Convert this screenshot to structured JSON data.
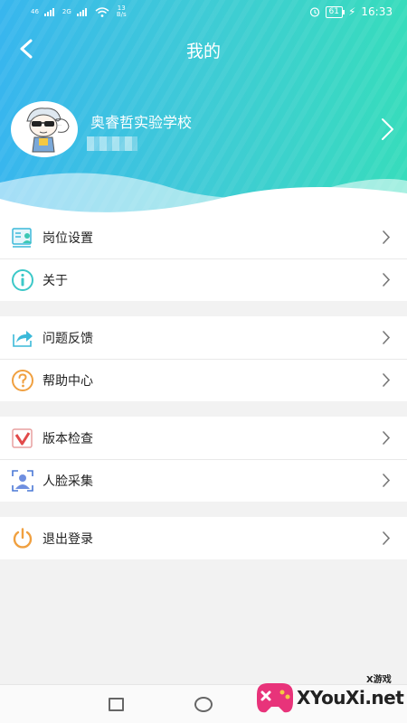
{
  "status_bar": {
    "left_labels": [
      "46",
      "2G"
    ],
    "speed_value": "13",
    "speed_unit": "B/s",
    "battery": "61",
    "time": "16:33"
  },
  "header": {
    "title": "我的",
    "back_icon": "back-arrow-icon"
  },
  "profile": {
    "school_name": "奥睿哲实验学校"
  },
  "menu": {
    "groups": [
      {
        "items": [
          {
            "label": "岗位设置",
            "icon": "position-settings-icon"
          },
          {
            "label": "关于",
            "icon": "info-icon"
          }
        ]
      },
      {
        "items": [
          {
            "label": "问题反馈",
            "icon": "feedback-share-icon"
          },
          {
            "label": "帮助中心",
            "icon": "help-icon"
          }
        ]
      },
      {
        "items": [
          {
            "label": "版本检查",
            "icon": "version-check-icon"
          },
          {
            "label": "人脸采集",
            "icon": "face-capture-icon"
          }
        ]
      },
      {
        "items": [
          {
            "label": "退出登录",
            "icon": "power-icon"
          }
        ]
      }
    ]
  },
  "colors": {
    "header_gradient_start": "#38b6ee",
    "header_gradient_end": "#37dcbc",
    "accent_orange": "#f0a040",
    "accent_cyan": "#3cc8c8"
  },
  "watermark": {
    "text": "XYouXi.net",
    "sub": "X游戏"
  }
}
